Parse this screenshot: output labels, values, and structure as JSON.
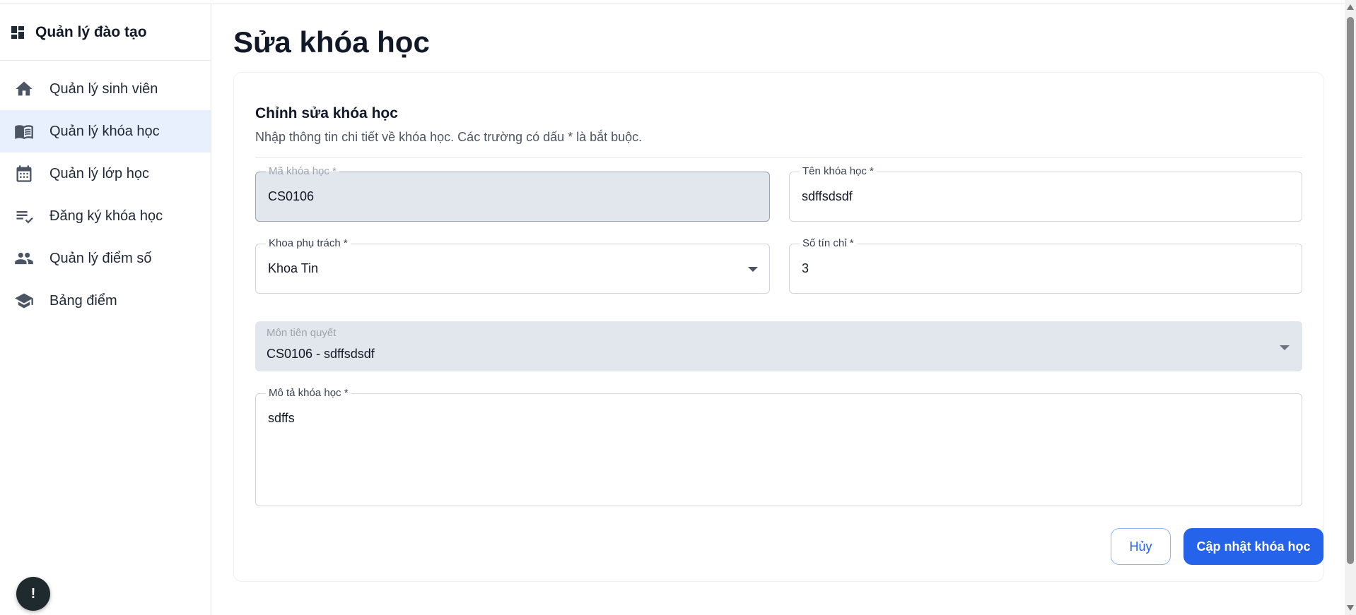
{
  "app": {
    "brand_title": "Quản lý đào tạo"
  },
  "sidebar": {
    "items": [
      {
        "label": "Quản lý sinh viên",
        "icon": "home-icon",
        "active": false
      },
      {
        "label": "Quản lý khóa học",
        "icon": "book-icon",
        "active": true
      },
      {
        "label": "Quản lý lớp học",
        "icon": "calendar-icon",
        "active": false
      },
      {
        "label": "Đăng ký khóa học",
        "icon": "checklist-icon",
        "active": false
      },
      {
        "label": "Quản lý điểm số",
        "icon": "people-icon",
        "active": false
      },
      {
        "label": "Bảng điểm",
        "icon": "graduation-cap-icon",
        "active": false
      }
    ],
    "help_label": "!"
  },
  "page": {
    "title": "Sửa khóa học"
  },
  "form": {
    "title": "Chỉnh sửa khóa học",
    "description": "Nhập thông tin chi tiết về khóa học. Các trường có dấu * là bắt buộc.",
    "course_code": {
      "label": "Mã khóa học *",
      "value": "CS0106",
      "disabled": true
    },
    "course_name": {
      "label": "Tên khóa học *",
      "value": "sdffsdsdf"
    },
    "department": {
      "label": "Khoa phụ trách *",
      "value": "Khoa Tin"
    },
    "credits": {
      "label": "Số tín chỉ *",
      "value": "3"
    },
    "prerequisite": {
      "label": "Môn tiên quyết",
      "value": "CS0106 - sdffsdsdf"
    },
    "description_field": {
      "label": "Mô tả khóa học *",
      "value": "sdffs"
    },
    "cancel_label": "Hủy",
    "submit_label": "Cập nhật khóa học"
  },
  "colors": {
    "accent": "#2563eb",
    "active_nav_bg": "#e8effd",
    "disabled_bg": "#e2e6ed"
  }
}
